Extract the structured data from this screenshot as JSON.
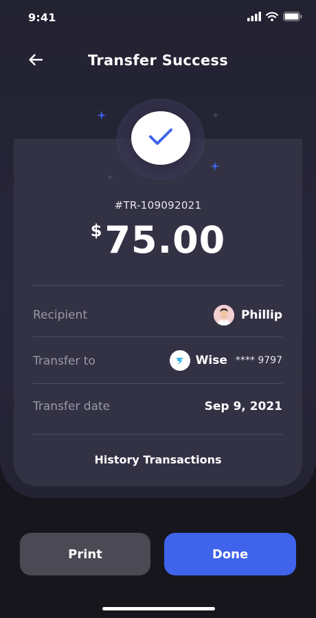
{
  "status_bar": {
    "time": "9:41"
  },
  "header": {
    "title": "Transfer Success"
  },
  "transaction": {
    "id": "#TR-109092021",
    "currency_symbol": "$",
    "amount": "75.00"
  },
  "details": {
    "recipient": {
      "label": "Recipient",
      "name": "Phillip"
    },
    "transfer_to": {
      "label": "Transfer to",
      "provider": "Wise",
      "account_masked": "**** 9797"
    },
    "transfer_date": {
      "label": "Transfer date",
      "value": "Sep 9, 2021"
    }
  },
  "history_link": "History Transactions",
  "actions": {
    "print_label": "Print",
    "done_label": "Done"
  },
  "colors": {
    "accent": "#3f63eb",
    "background": "#17161d",
    "card": "#333245"
  },
  "icons": [
    "signal-icon",
    "wifi-icon",
    "battery-icon",
    "back-arrow-icon",
    "checkmark-icon",
    "sparkle-icon",
    "avatar",
    "wise-logo-icon"
  ]
}
